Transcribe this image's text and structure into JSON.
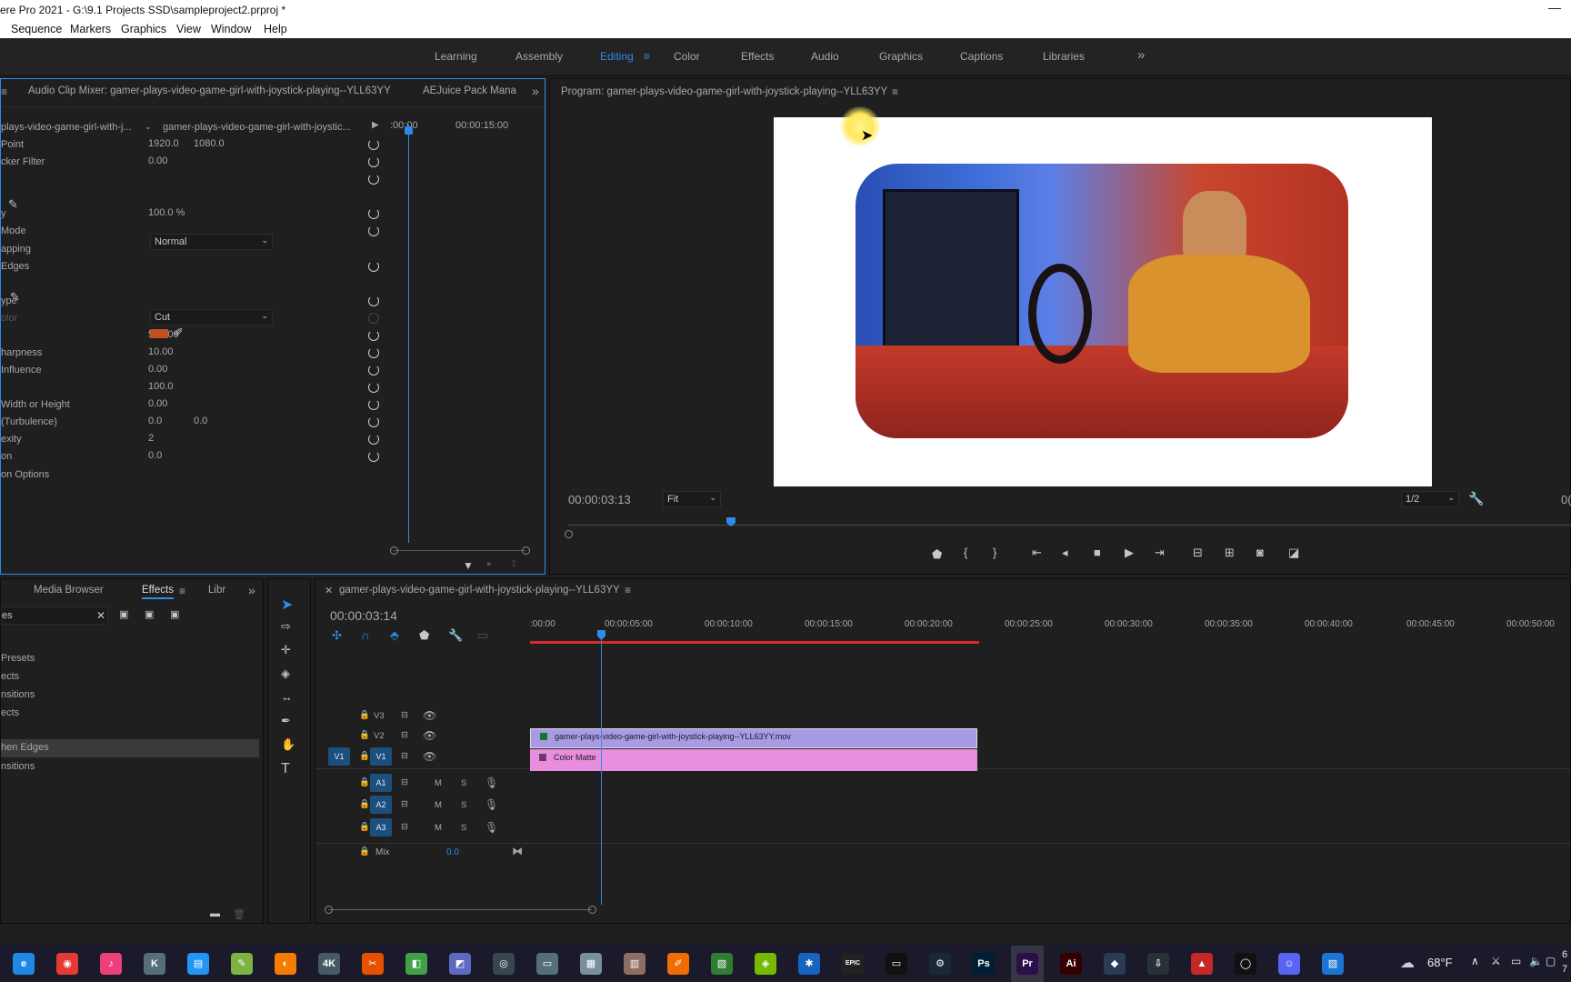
{
  "window": {
    "title": "ere Pro 2021 - G:\\9.1 Projects SSD\\sampleproject2.prproj *",
    "minimize_glyph": "—"
  },
  "menubar": {
    "items": [
      "Sequence",
      "Markers",
      "Graphics",
      "View",
      "Window",
      "Help"
    ]
  },
  "workspaces": {
    "items": [
      "Learning",
      "Assembly",
      "Editing",
      "Color",
      "Effects",
      "Audio",
      "Graphics",
      "Captions",
      "Libraries"
    ],
    "active": "Editing",
    "more_glyph": "»"
  },
  "effect_controls": {
    "tabs": [
      "Audio Clip Mixer: gamer-plays-video-game-girl-with-joystick-playing--YLL63YY",
      "AEJuice Pack Mana"
    ],
    "master_clip": "plays-video-game-girl-with-j...",
    "sequence_clip": "gamer-plays-video-game-girl-with-joystic...",
    "time_start": ":00:00",
    "time_end": "00:00:15:00",
    "params": [
      {
        "label": "Point",
        "v1": "1920.0",
        "v2": "1080.0"
      },
      {
        "label": "cker Filter",
        "v1": "0.00",
        "v2": ""
      },
      {
        "label": "",
        "v1": "",
        "v2": ""
      },
      {
        "label": "",
        "v1": "",
        "v2": ""
      },
      {
        "label": "y",
        "v1": "100.0 %",
        "v2": ""
      },
      {
        "label": "Mode",
        "v1": "",
        "v2": ""
      },
      {
        "label": "apping",
        "v1": "",
        "v2": ""
      },
      {
        "label": "Edges",
        "v1": "",
        "v2": ""
      },
      {
        "label": "",
        "v1": "",
        "v2": ""
      },
      {
        "label": "ype",
        "v1": "",
        "v2": ""
      },
      {
        "label": "olor",
        "v1": "",
        "v2": ""
      },
      {
        "label": "",
        "v1": "500.00",
        "v2": ""
      },
      {
        "label": "harpness",
        "v1": "10.00",
        "v2": ""
      },
      {
        "label": " Influence",
        "v1": "0.00",
        "v2": ""
      },
      {
        "label": "",
        "v1": "100.0",
        "v2": ""
      },
      {
        "label": " Width or Height",
        "v1": "0.00",
        "v2": ""
      },
      {
        "label": " (Turbulence)",
        "v1": "0.0",
        "v2": "0.0"
      },
      {
        "label": "exity",
        "v1": "2",
        "v2": ""
      },
      {
        "label": "on",
        "v1": "0.0",
        "v2": ""
      },
      {
        "label": "on Options",
        "v1": "",
        "v2": ""
      }
    ],
    "blend_mode": "Normal",
    "type_value": "Cut",
    "color_swatch": "#c0501e"
  },
  "program_monitor": {
    "title": "Program: gamer-plays-video-game-girl-with-joystick-playing--YLL63YY",
    "timecode": "00:00:03:13",
    "fit": "Fit",
    "resolution": "1/2",
    "right_timecode": "0("
  },
  "project_panel": {
    "tabs": [
      "Media Browser",
      "Effects",
      "Libr"
    ],
    "active_tab": "Effects",
    "search_value": "es",
    "items": [
      "Presets",
      "ects",
      "nsitions",
      "ects",
      "",
      "hen Edges",
      "nsitions"
    ],
    "selected_index": 5
  },
  "timeline": {
    "sequence_name": "gamer-plays-video-game-girl-with-joystick-playing--YLL63YY",
    "timecode": "00:00:03:14",
    "ruler": [
      ":00:00",
      "00:00:05:00",
      "00:00:10:00",
      "00:00:15:00",
      "00:00:20:00",
      "00:00:25:00",
      "00:00:30:00",
      "00:00:35:00",
      "00:00:40:00",
      "00:00:45:00",
      "00:00:50:00"
    ],
    "tracks_video": [
      "V3",
      "V2",
      "V1"
    ],
    "tracks_audio": [
      "A1",
      "A2",
      "A3"
    ],
    "source_patch": "V1",
    "mix_label": "Mix",
    "mix_value": "0.0",
    "audio_m": "M",
    "audio_s": "S",
    "clip_v2": "gamer-plays-video-game-girl-with-joystick-playing--YLL63YY.mov",
    "clip_v1": "Color Matte",
    "clip_v2_color": "#a99ae6",
    "clip_v1_color": "#e98ddf"
  },
  "tools": {
    "names": [
      "selection-tool",
      "track-select-tool",
      "ripple-edit-tool",
      "razor-tool",
      "slip-tool",
      "pen-tool",
      "hand-tool",
      "type-tool"
    ]
  },
  "taskbar": {
    "weather": "68°F",
    "time_partial": "6",
    "date_partial": "7"
  },
  "colors": {
    "accent": "#2d8ceb",
    "playhead": "#2d8ceb",
    "work_area": "#d62b2b"
  }
}
